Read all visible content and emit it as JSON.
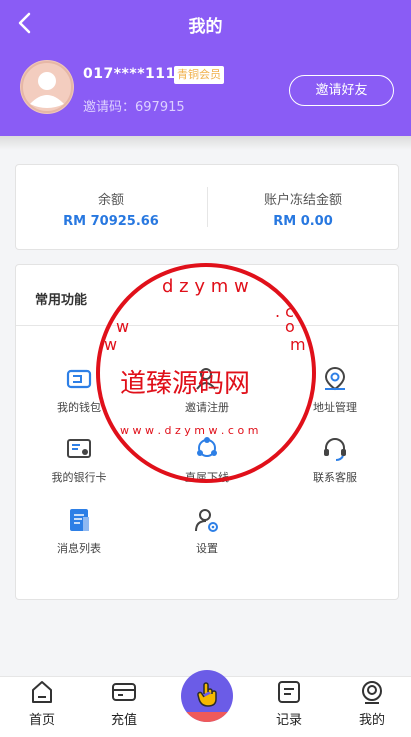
{
  "header": {
    "title": "我的",
    "phone": "017****1111",
    "member_badge": "青铜会员",
    "invite_code_label": "邀请码：697915",
    "invite_button": "邀请好友"
  },
  "balance": {
    "balance_label": "余额",
    "balance_value": "RM 70925.66",
    "frozen_label": "账户冻结金额",
    "frozen_value": "RM 0.00"
  },
  "functions": {
    "title": "常用功能",
    "items": [
      {
        "label": "我的钱包",
        "icon": "wallet-icon"
      },
      {
        "label": "邀请注册",
        "icon": "invite-user-icon"
      },
      {
        "label": "地址管理",
        "icon": "location-pin-icon"
      },
      {
        "label": "我的银行卡",
        "icon": "bank-card-icon"
      },
      {
        "label": "直属下线",
        "icon": "team-network-icon"
      },
      {
        "label": "联系客服",
        "icon": "headset-icon"
      },
      {
        "label": "消息列表",
        "icon": "message-list-icon"
      },
      {
        "label": "设置",
        "icon": "user-settings-icon"
      }
    ]
  },
  "watermark": {
    "main_text": "道臻源码网",
    "url_text": "w w w . d z y m w . c o m"
  },
  "tabbar": {
    "items": [
      {
        "label": "首页",
        "icon": "home-icon"
      },
      {
        "label": "充值",
        "icon": "wallet-card-icon"
      },
      {
        "label": "",
        "icon": "hand-tap-icon"
      },
      {
        "label": "记录",
        "icon": "record-icon"
      },
      {
        "label": "我的",
        "icon": "user-profile-icon"
      }
    ]
  },
  "colors": {
    "header_bg": "#8a5cf5",
    "accent_blue": "#2878e0",
    "badge_text": "#f0b04a",
    "watermark_red": "#e0101a",
    "fab_purple": "#6b5ce7"
  }
}
